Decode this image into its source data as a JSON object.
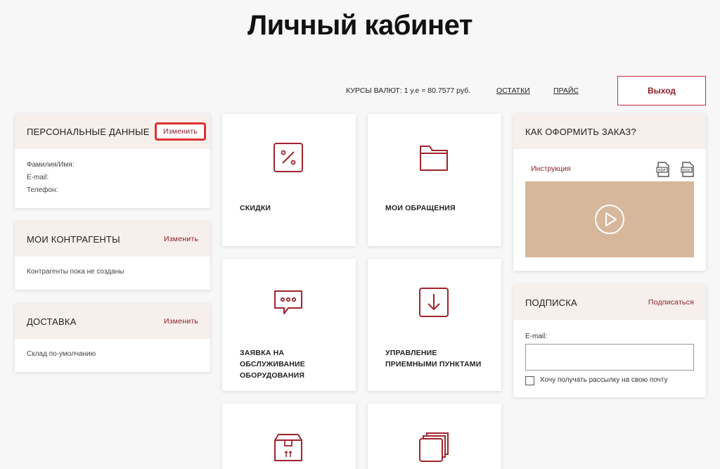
{
  "title": "Личный кабинет",
  "topbar": {
    "rates": "КУРСЫ ВАЛЮТ: 1 у.е = 80.7577 руб.",
    "stock_link": "ОСТАТКИ",
    "price_link": "ПРАЙС",
    "logout_label": "Выход"
  },
  "personal": {
    "title": "ПЕРСОНАЛЬНЫЕ ДАННЫЕ",
    "edit_label": "Изменить",
    "fields": [
      "Фамилия/Имя:",
      "E-mail:",
      "Телефон:"
    ]
  },
  "contractors": {
    "title": "МОИ КОНТРАГЕНТЫ",
    "edit_label": "Изменить",
    "text": "Контрагенты пока не созданы"
  },
  "delivery": {
    "title": "ДОСТАВКА",
    "edit_label": "Изменить",
    "text": "Склад по-умолчанию"
  },
  "tiles": [
    {
      "label": "Скидки",
      "icon": "percent-icon"
    },
    {
      "label": "Мои обращения",
      "icon": "folder-icon"
    },
    {
      "label": "Заявка на обслуживание оборудования",
      "icon": "chat-bubble-icon"
    },
    {
      "label": "Управление приемными пунктами",
      "icon": "download-box-icon"
    },
    {
      "label": "",
      "icon": "package-box-icon"
    },
    {
      "label": "",
      "icon": "stack-icon"
    }
  ],
  "order_help": {
    "title": "КАК ОФОРМИТЬ ЗАКАЗ?",
    "instruction_label": "Инструкция",
    "pdf_icon": "pdf-file-icon",
    "doc_icon": "doc-file-icon",
    "video_icon": "play-icon"
  },
  "subscription": {
    "title": "ПОДПИСКА",
    "subscribe_label": "Подписаться",
    "email_label": "E-mail:",
    "email_value": "",
    "checkbox_label": "Хочу получать рассылку на свою почту"
  },
  "colors": {
    "accent": "#8b1f2a",
    "card_header": "#f6efeb",
    "video_bg": "#d7b79b",
    "highlight_border": "#e03030"
  }
}
